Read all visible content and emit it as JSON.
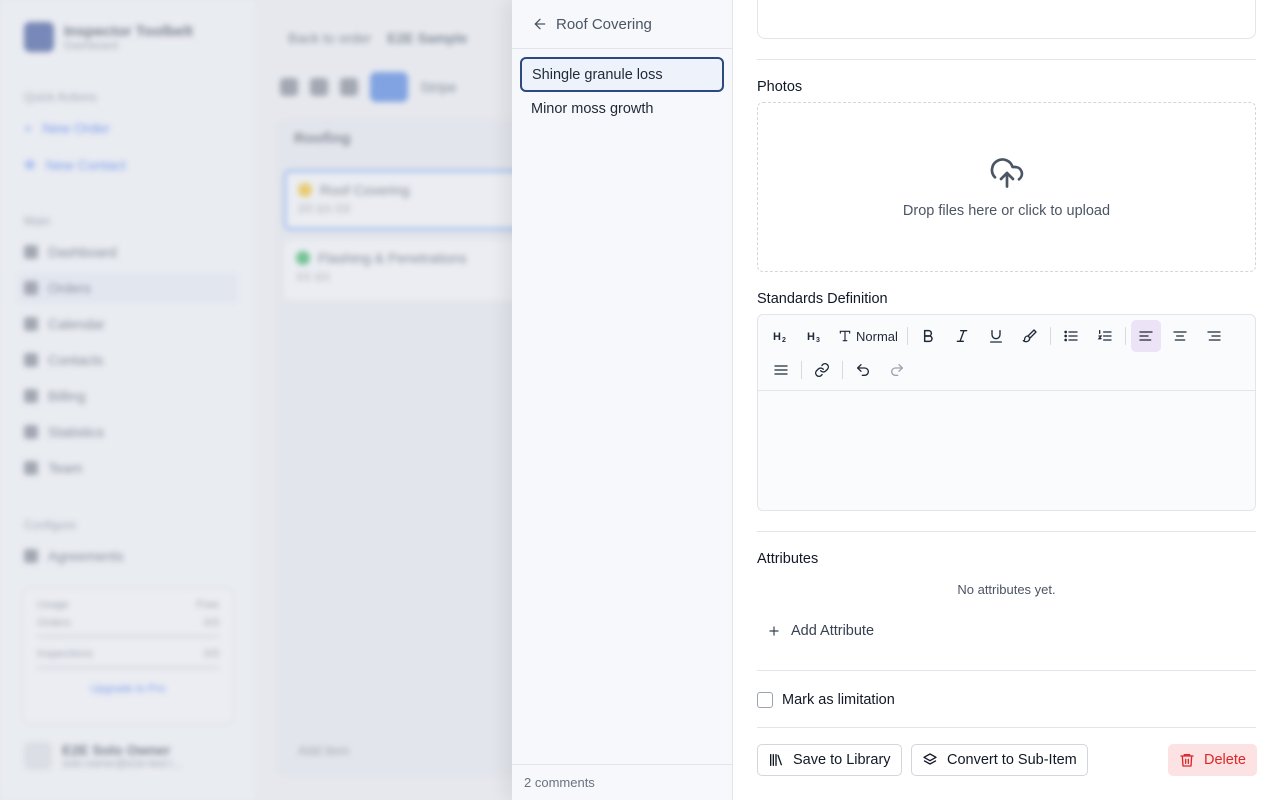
{
  "background": {
    "brand_title": "Inspector Toolbelt",
    "brand_subtitle": "Dashboard",
    "quick_actions_heading": "Quick Actions",
    "quick_actions": [
      "New Order",
      "New Contact"
    ],
    "main_heading": "Main",
    "nav": [
      "Dashboard",
      "Orders",
      "Calendar",
      "Contacts",
      "Billing",
      "Statistics",
      "Team"
    ],
    "configure_heading": "Configure",
    "configure": [
      "Agreements"
    ],
    "usage": {
      "heading": "Usage",
      "plan": "Free",
      "rows": [
        {
          "label": "Orders",
          "value": "0/3"
        },
        {
          "label": "Inspections",
          "value": "0/3"
        }
      ],
      "upgrade": "Upgrade to Pro"
    },
    "user_name": "E2E Solo Owner",
    "user_email": "solo-owner@e2e-test.l...",
    "breadcrumb": {
      "back": "Back to order",
      "title": "E2E Sample"
    },
    "toolbar_label": "Stripe",
    "column": {
      "title": "Roofing",
      "cards": [
        {
          "title": "Roof Covering",
          "meta": "2/2  ◎1  ⊡2",
          "color": "#eab308"
        },
        {
          "title": "Flashing & Penetrations",
          "meta": "1/1  ◎1",
          "color": "#16a34a"
        }
      ],
      "add_label": "Add item"
    }
  },
  "drawer": {
    "back_label": "Roof Covering",
    "items": [
      "Shingle granule loss",
      "Minor moss growth"
    ],
    "selected_index": 0,
    "comments": "2 comments",
    "photos_label": "Photos",
    "upload_text": "Drop files here or click to upload",
    "standards_label": "Standards Definition",
    "editor": {
      "text_style": "Normal",
      "active_alignment": "left"
    },
    "attributes_label": "Attributes",
    "no_attributes": "No attributes yet.",
    "add_attribute": "Add Attribute",
    "limitation_label": "Mark as limitation",
    "limitation_checked": false,
    "actions": {
      "save_library": "Save to Library",
      "convert": "Convert to Sub-Item",
      "delete": "Delete"
    },
    "colors": {
      "accent_selected": "#2c4a7e",
      "active_toolbar": "#ede3f7",
      "danger": "#dc2626"
    }
  }
}
